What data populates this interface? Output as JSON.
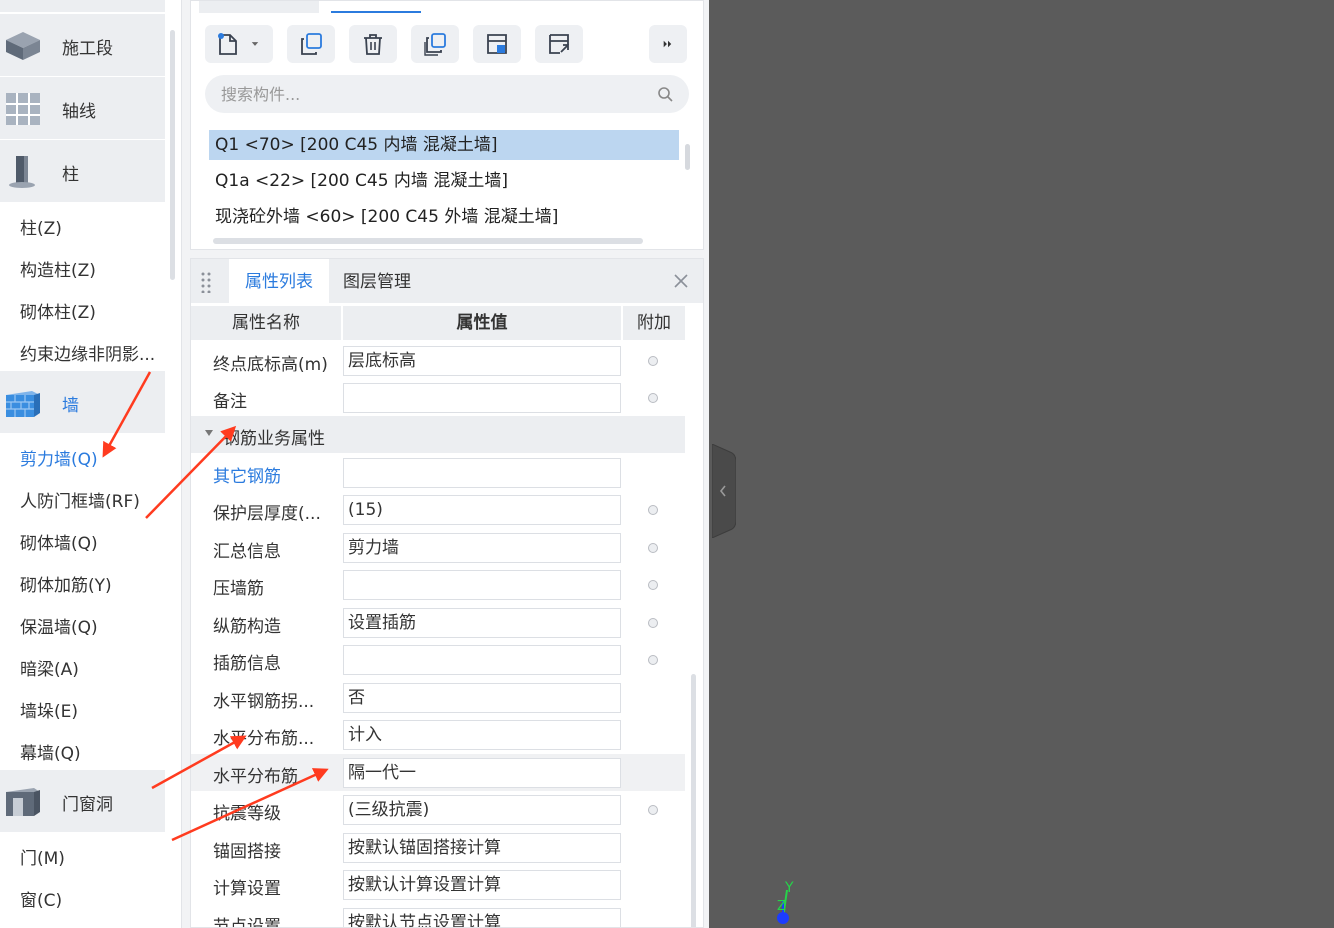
{
  "nav": {
    "categories": [
      {
        "label": "施工段"
      },
      {
        "label": "轴线"
      },
      {
        "label": "柱"
      },
      {
        "label": "墙"
      },
      {
        "label": "门窗洞"
      }
    ],
    "column_items": [
      "柱(Z)",
      "构造柱(Z)",
      "砌体柱(Z)",
      "约束边缘非阴影..."
    ],
    "wall_items": [
      "剪力墙(Q)",
      "人防门框墙(RF)",
      "砌体墙(Q)",
      "砌体加筋(Y)",
      "保温墙(Q)",
      "暗梁(A)",
      "墙垛(E)",
      "幕墙(Q)"
    ],
    "opening_items": [
      "门(M)",
      "窗(C)"
    ]
  },
  "components": {
    "search_placeholder": "搜索构件...",
    "items": [
      "Q1 <70> [200 C45 内墙 混凝土墙]",
      "Q1a <22> [200 C45 内墙 混凝土墙]",
      "现浇砼外墙 <60> [200 C45 外墙 混凝土墙]"
    ]
  },
  "properties": {
    "tabs": [
      "属性列表",
      "图层管理"
    ],
    "headers": {
      "name": "属性名称",
      "value": "属性值",
      "extra": "附加"
    },
    "rows_top": [
      {
        "name": "终点底标高(m)",
        "value": "层底标高"
      },
      {
        "name": "备注",
        "value": ""
      }
    ],
    "group_label": "钢筋业务属性",
    "rows": [
      {
        "name": "其它钢筋",
        "value": ""
      },
      {
        "name": "保护层厚度(...",
        "value": "(15)"
      },
      {
        "name": "汇总信息",
        "value": "剪力墙"
      },
      {
        "name": "压墙筋",
        "value": ""
      },
      {
        "name": "纵筋构造",
        "value": "设置插筋"
      },
      {
        "name": "插筋信息",
        "value": ""
      },
      {
        "name": "水平钢筋拐...",
        "value": "否"
      },
      {
        "name": "水平分布筋...",
        "value": "计入"
      },
      {
        "name": "水平分布筋",
        "value": "隔一代一"
      },
      {
        "name": "抗震等级",
        "value": "(三级抗震)"
      },
      {
        "name": "锚固搭接",
        "value": "按默认锚固搭接计算"
      },
      {
        "name": "计算设置",
        "value": "按默认计算设置计算"
      },
      {
        "name": "节点设置",
        "value": "按默认节点设置计算"
      }
    ]
  },
  "viewport": {
    "axis_labels": [
      "Y",
      "Z"
    ]
  },
  "colors": {
    "accent": "#2b7bde",
    "selected_row": "#bcd6f0",
    "viewport_bg": "#5b5b5b",
    "annotation_arrow": "#ff3b1f"
  }
}
